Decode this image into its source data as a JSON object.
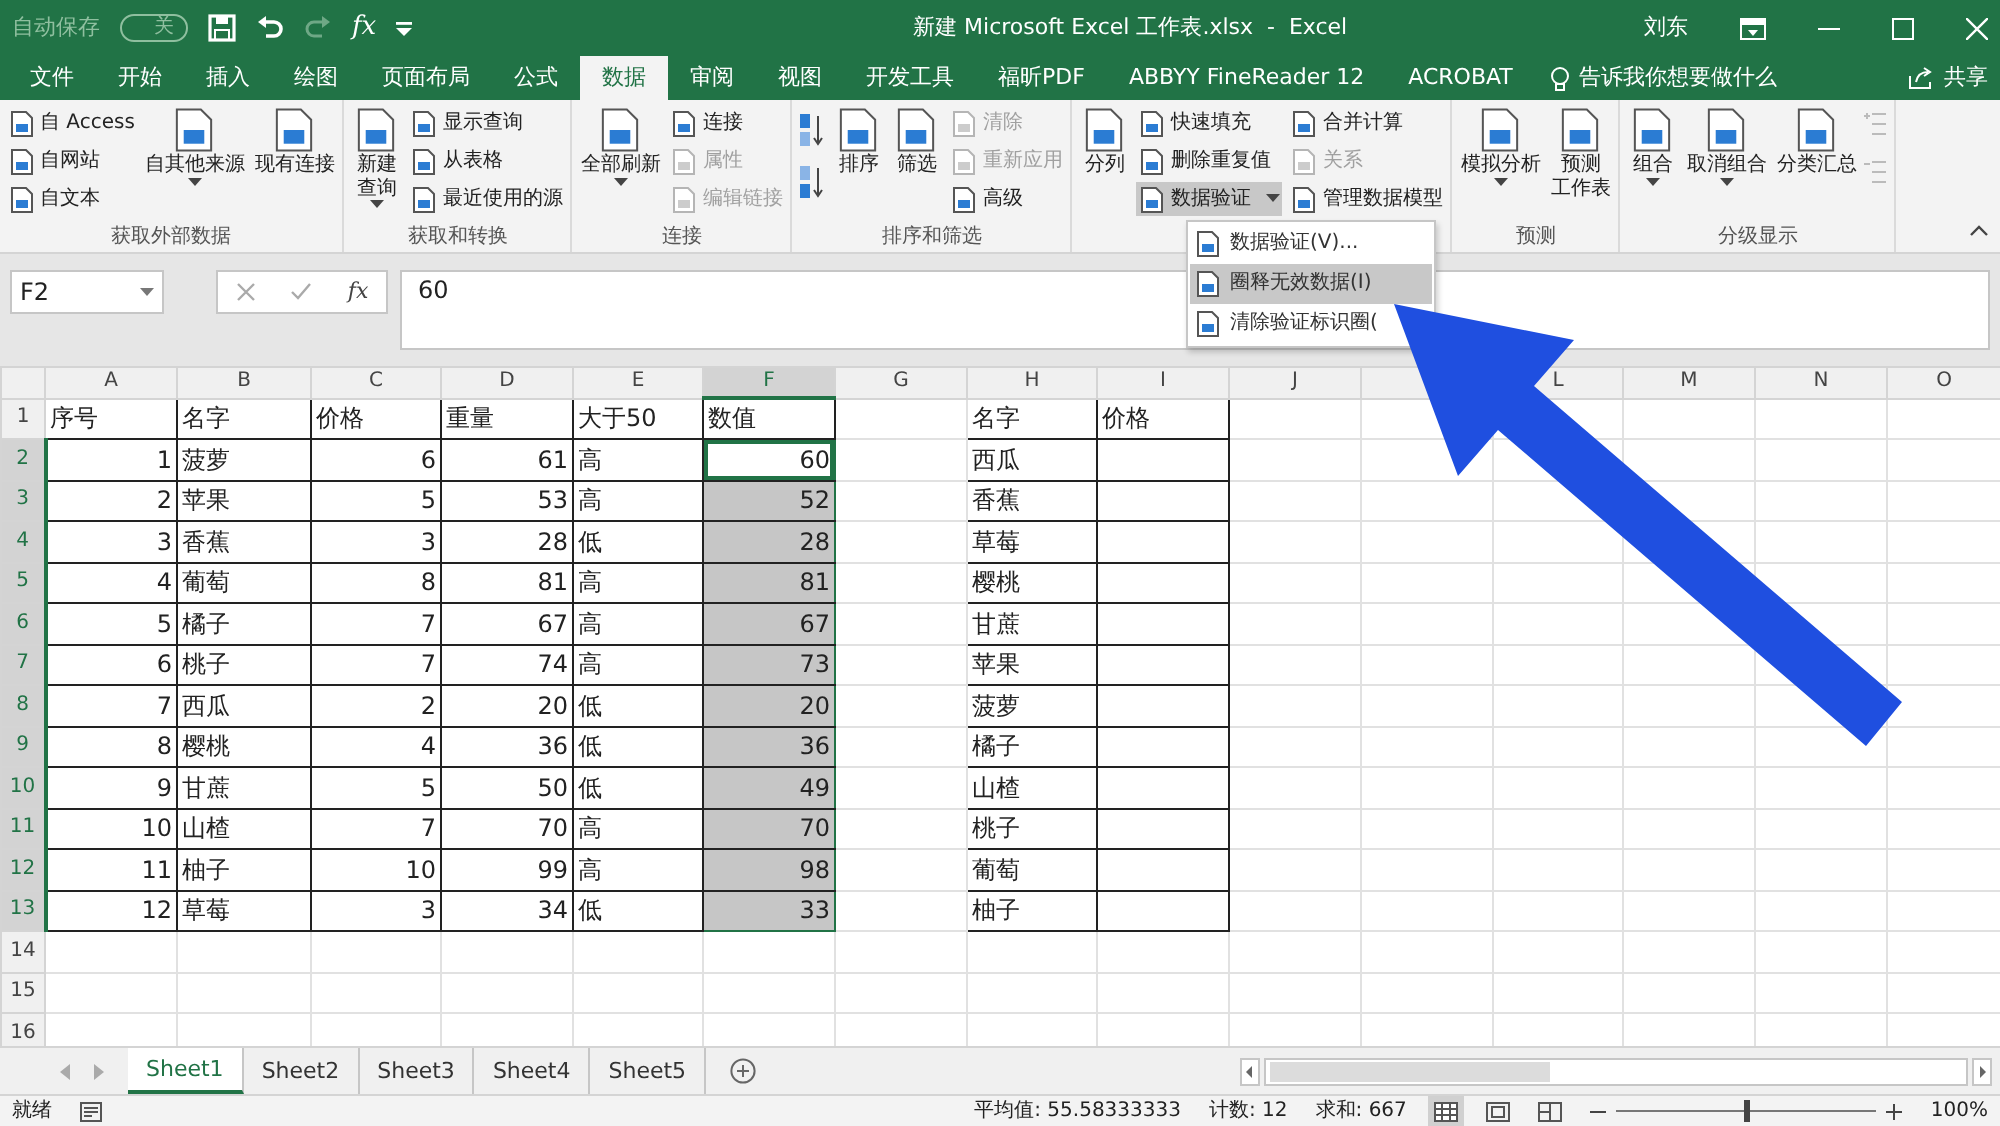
{
  "title_bar": {
    "autosave": {
      "label": "自动保存",
      "state": "关",
      "on": false
    },
    "insert_function": "fx",
    "title": "新建 Microsoft Excel 工作表.xlsx  -  Excel",
    "user": "刘东"
  },
  "tabs": [
    {
      "label": "文件",
      "selected": false
    },
    {
      "label": "开始",
      "selected": false
    },
    {
      "label": "插入",
      "selected": false
    },
    {
      "label": "绘图",
      "selected": false
    },
    {
      "label": "页面布局",
      "selected": false
    },
    {
      "label": "公式",
      "selected": false
    },
    {
      "label": "数据",
      "selected": true
    },
    {
      "label": "审阅",
      "selected": false
    },
    {
      "label": "视图",
      "selected": false
    },
    {
      "label": "开发工具",
      "selected": false
    },
    {
      "label": "福昕PDF",
      "selected": false
    },
    {
      "label": "ABBYY FineReader 12",
      "selected": false
    },
    {
      "label": "ACROBAT",
      "selected": false
    }
  ],
  "tell_me": "告诉我你想要做什么",
  "share": "共享",
  "ribbon": [
    {
      "name": "获取外部数据",
      "columns": [
        {
          "kind": "stack",
          "items": [
            {
              "label": "自 Access",
              "disabled": false
            },
            {
              "label": "自网站",
              "disabled": false
            },
            {
              "label": "自文本",
              "disabled": false
            }
          ]
        },
        {
          "kind": "large",
          "label": "自其他来源",
          "dropdown": true
        },
        {
          "kind": "large",
          "label": "现有连接",
          "dropdown": false
        }
      ]
    },
    {
      "name": "获取和转换",
      "columns": [
        {
          "kind": "large",
          "lines": [
            "新建",
            "查询"
          ],
          "dropdown": true
        },
        {
          "kind": "stack",
          "items": [
            {
              "label": "显示查询",
              "disabled": false
            },
            {
              "label": "从表格",
              "disabled": false
            },
            {
              "label": "最近使用的源",
              "disabled": false
            }
          ]
        }
      ]
    },
    {
      "name": "连接",
      "columns": [
        {
          "kind": "large",
          "label": "全部刷新",
          "dropdown": true
        },
        {
          "kind": "stack",
          "items": [
            {
              "label": "连接",
              "disabled": false
            },
            {
              "label": "属性",
              "disabled": true
            },
            {
              "label": "编辑链接",
              "disabled": true
            }
          ]
        }
      ]
    },
    {
      "name": "排序和筛选",
      "columns": [
        {
          "kind": "sort_icons"
        },
        {
          "kind": "large",
          "label": "排序",
          "dropdown": false
        },
        {
          "kind": "large",
          "label": "筛选",
          "dropdown": false
        },
        {
          "kind": "stack",
          "items": [
            {
              "label": "清除",
              "disabled": true
            },
            {
              "label": "重新应用",
              "disabled": true
            },
            {
              "label": "高级",
              "disabled": false
            }
          ]
        }
      ]
    },
    {
      "columns": [
        {
          "kind": "large",
          "label": "分列",
          "dropdown": false
        },
        {
          "kind": "stack",
          "items": [
            {
              "label": "快速填充",
              "disabled": false
            },
            {
              "label": "删除重复值",
              "disabled": false
            },
            {
              "label": "数据验证",
              "disabled": false,
              "dropdown": true,
              "expanded": true
            }
          ]
        },
        {
          "kind": "stack",
          "items": [
            {
              "label": "合并计算",
              "disabled": false
            },
            {
              "label": "关系",
              "disabled": true
            },
            {
              "label": "管理数据模型",
              "disabled": false
            }
          ]
        }
      ]
    },
    {
      "name": "预测",
      "columns": [
        {
          "kind": "large",
          "label": "模拟分析",
          "dropdown": true
        },
        {
          "kind": "large",
          "lines": [
            "预测",
            "工作表"
          ],
          "dropdown": false
        }
      ]
    },
    {
      "name": "分级显示",
      "columns": [
        {
          "kind": "large",
          "label": "组合",
          "dropdown": true
        },
        {
          "kind": "large",
          "label": "取消组合",
          "dropdown": true
        },
        {
          "kind": "large",
          "label": "分类汇总",
          "dropdown": false
        },
        {
          "kind": "icon_stack"
        }
      ]
    }
  ],
  "menu": [
    {
      "label": "数据验证(V)...",
      "selected": false
    },
    {
      "label": "圈释无效数据(I)",
      "selected": true
    },
    {
      "label": "清除验证标识圈(",
      "selected": false
    }
  ],
  "formula_bar": {
    "name_box": "F2",
    "insert_function": "fx",
    "value": "60"
  },
  "sheet": {
    "columns": [
      {
        "letter": "A",
        "numeric": true,
        "bordered": true,
        "selected": false
      },
      {
        "letter": "B",
        "numeric": false,
        "bordered": true,
        "selected": false
      },
      {
        "letter": "C",
        "numeric": true,
        "bordered": true,
        "selected": false
      },
      {
        "letter": "D",
        "numeric": true,
        "bordered": true,
        "selected": false
      },
      {
        "letter": "E",
        "numeric": false,
        "bordered": true,
        "selected": false
      },
      {
        "letter": "F",
        "numeric": true,
        "bordered": true,
        "selected": true
      },
      {
        "letter": "G",
        "selected": false
      },
      {
        "letter": "H",
        "numeric": false,
        "bordered": true,
        "selected": false
      },
      {
        "letter": "I",
        "bordered": true,
        "selected": false
      },
      {
        "letter": "J",
        "selected": false
      },
      {},
      {
        "letter": "L",
        "selected": false
      },
      {
        "letter": "M",
        "selected": false
      },
      {
        "letter": "N",
        "selected": false
      },
      {
        "letter": "O",
        "selected": false
      }
    ],
    "rows": [
      {
        "number": "1",
        "kind": "header",
        "selected": false,
        "cells": [
          "序号",
          "名字",
          "价格",
          "重量",
          "大于50",
          "数值",
          null,
          "名字",
          "价格"
        ]
      },
      {
        "number": "2",
        "kind": "data",
        "selected": true,
        "active": true,
        "cells": [
          "1",
          "菠萝",
          "6",
          "61",
          "高",
          "60",
          null,
          "西瓜"
        ]
      },
      {
        "number": "3",
        "kind": "data",
        "selected": true,
        "cells": [
          "2",
          "苹果",
          "5",
          "53",
          "高",
          "52",
          null,
          "香蕉"
        ]
      },
      {
        "number": "4",
        "kind": "data",
        "selected": true,
        "cells": [
          "3",
          "香蕉",
          "3",
          "28",
          "低",
          "28",
          null,
          "草莓"
        ]
      },
      {
        "number": "5",
        "kind": "data",
        "selected": true,
        "cells": [
          "4",
          "葡萄",
          "8",
          "81",
          "高",
          "81",
          null,
          "樱桃"
        ]
      },
      {
        "number": "6",
        "kind": "data",
        "selected": true,
        "cells": [
          "5",
          "橘子",
          "7",
          "67",
          "高",
          "67",
          null,
          "甘蔗"
        ]
      },
      {
        "number": "7",
        "kind": "data",
        "selected": true,
        "cells": [
          "6",
          "桃子",
          "7",
          "74",
          "高",
          "73",
          null,
          "苹果"
        ]
      },
      {
        "number": "8",
        "kind": "data",
        "selected": true,
        "cells": [
          "7",
          "西瓜",
          "2",
          "20",
          "低",
          "20",
          null,
          "菠萝"
        ]
      },
      {
        "number": "9",
        "kind": "data",
        "selected": true,
        "cells": [
          "8",
          "樱桃",
          "4",
          "36",
          "低",
          "36",
          null,
          "橘子"
        ]
      },
      {
        "number": "10",
        "kind": "data",
        "selected": true,
        "cells": [
          "9",
          "甘蔗",
          "5",
          "50",
          "低",
          "49",
          null,
          "山楂"
        ]
      },
      {
        "number": "11",
        "kind": "data",
        "selected": true,
        "cells": [
          "10",
          "山楂",
          "7",
          "70",
          "高",
          "70",
          null,
          "桃子"
        ]
      },
      {
        "number": "12",
        "kind": "data",
        "selected": true,
        "cells": [
          "11",
          "柚子",
          "10",
          "99",
          "高",
          "98",
          null,
          "葡萄"
        ]
      },
      {
        "number": "13",
        "kind": "data",
        "selected": true,
        "cells": [
          "12",
          "草莓",
          "3",
          "34",
          "低",
          "33",
          null,
          "柚子"
        ]
      },
      {
        "number": "14",
        "kind": "data",
        "selected": false
      },
      {
        "number": "15",
        "kind": "data",
        "selected": false
      },
      {
        "number": "16",
        "kind": "data",
        "selected": false
      }
    ]
  },
  "sheet_tabs": [
    {
      "label": "Sheet1",
      "selected": true
    },
    {
      "label": "Sheet2",
      "selected": false
    },
    {
      "label": "Sheet3",
      "selected": false
    },
    {
      "label": "Sheet4",
      "selected": false
    },
    {
      "label": "Sheet5",
      "selected": false
    }
  ],
  "status_bar": {
    "status": "就绪",
    "average": "平均值: 55.58333333",
    "count": "计数: 12",
    "sum": "求和: 667",
    "zoom": {
      "level": 0.5,
      "reading": "100%"
    }
  }
}
